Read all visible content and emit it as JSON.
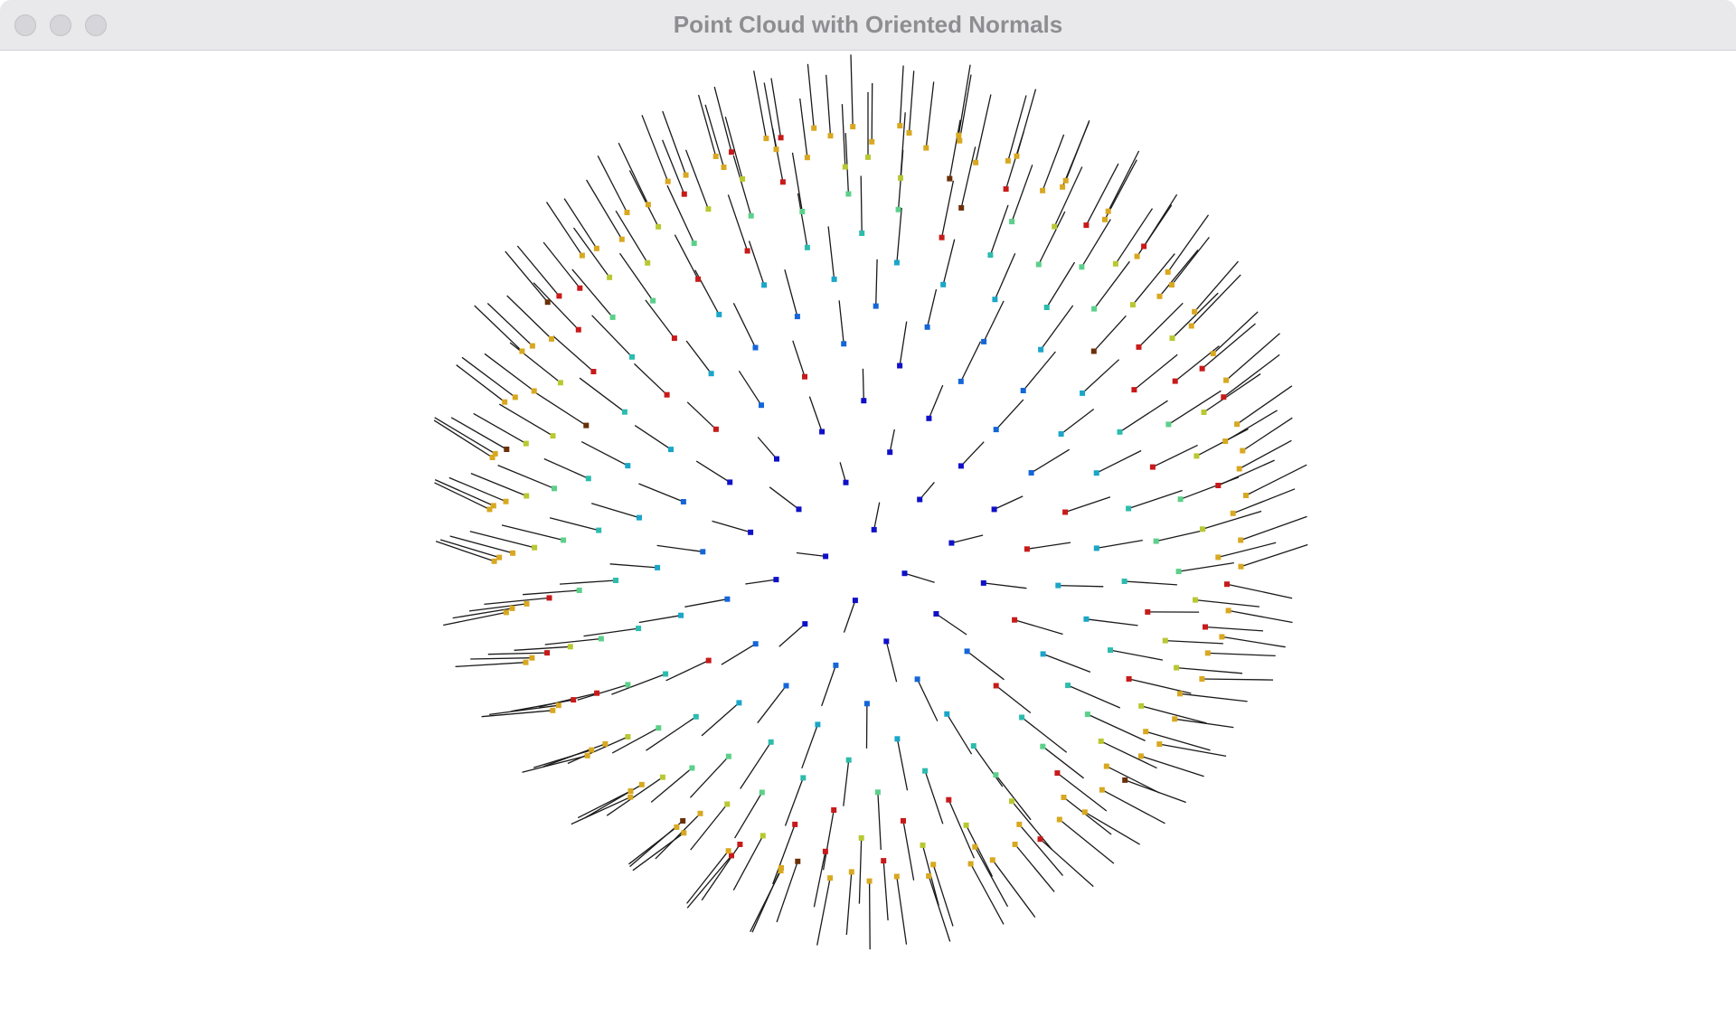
{
  "window": {
    "title": "Point Cloud with Oriented Normals"
  },
  "viewer": {
    "background_color": "#ffffff",
    "normal_line_color": "#1a1a1a",
    "point_colors": [
      "#1010c8",
      "#1466d8",
      "#1aa6c8",
      "#2cbcae",
      "#5cd08a",
      "#b8c832",
      "#d8a820",
      "#c81a1a",
      "#6a3008"
    ],
    "point_count": 600
  },
  "icons": {
    "close": "traffic-light-close-icon",
    "minimize": "traffic-light-minimize-icon",
    "zoom": "traffic-light-zoom-icon"
  }
}
